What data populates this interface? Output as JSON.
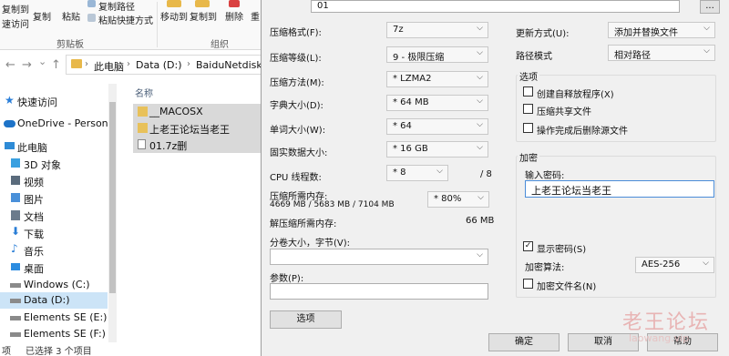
{
  "explorer": {
    "ribbon": {
      "copy_to_label": "复制到",
      "access_label": "速访问",
      "copy_label": "复制",
      "paste_label": "粘贴",
      "copy_path_label": "复制路径",
      "paste_shortcut_label": "粘贴快捷方式",
      "clipboard_group": "剪贴板",
      "move_to_label": "移动到",
      "copy_to2_label": "复制到",
      "delete_label": "删除",
      "rename_label": "重",
      "organize_group": "组织"
    },
    "address": {
      "back": "←",
      "forward": "→",
      "dropdown": "⌄",
      "up": "↑",
      "crumbs": [
        "此电脑",
        "Data (D:)",
        "BaiduNetdiskDown"
      ],
      "separator": "›"
    },
    "nav": [
      {
        "label": "快速访问",
        "icon": "star-icon",
        "color": "#2b7fd9"
      },
      {
        "label": "OneDrive - Personal",
        "icon": "cloud-icon",
        "color": "#1e73c8"
      },
      {
        "label": "此电脑",
        "icon": "computer-icon",
        "color": "#2e8bd6"
      },
      {
        "label": "3D 对象",
        "icon": "cube-icon",
        "color": "#3aa0e0"
      },
      {
        "label": "视频",
        "icon": "video-icon",
        "color": "#5a6b7c"
      },
      {
        "label": "图片",
        "icon": "image-icon",
        "color": "#4a90d9"
      },
      {
        "label": "文档",
        "icon": "document-icon",
        "color": "#6b7b8c"
      },
      {
        "label": "下载",
        "icon": "download-icon",
        "color": "#2a7ed6"
      },
      {
        "label": "音乐",
        "icon": "music-icon",
        "color": "#2a7ed6"
      },
      {
        "label": "桌面",
        "icon": "desktop-icon",
        "color": "#2b8ce0"
      },
      {
        "label": "Windows (C:)",
        "icon": "drive-icon",
        "color": "#888888"
      },
      {
        "label": "Data (D:)",
        "icon": "drive-icon",
        "color": "#888888"
      },
      {
        "label": "Elements SE (E:)",
        "icon": "drive-icon",
        "color": "#888888"
      },
      {
        "label": "Elements SE (F:)",
        "icon": "drive-icon",
        "color": "#888888"
      }
    ],
    "column_header": "名称",
    "files": [
      {
        "name": "__MACOSX",
        "icon": "folder-icon"
      },
      {
        "name": "上老王论坛当老王",
        "icon": "folder-icon"
      },
      {
        "name": "01.7z删",
        "icon": "file-icon"
      }
    ],
    "status": {
      "items": "项",
      "selected": "已选择 3 个项目"
    }
  },
  "dialog": {
    "archive_name": "01",
    "browse_label": "...",
    "format_label": "压缩格式(F):",
    "format_value": "7z",
    "level_label": "压缩等级(L):",
    "level_value": "9 - 极限压缩",
    "method_label": "压缩方法(M):",
    "method_value": "* LZMA2",
    "dict_label": "字典大小(D):",
    "dict_value": "* 64 MB",
    "word_label": "单词大小(W):",
    "word_value": "* 64",
    "solid_label": "固实数据大小:",
    "solid_value": "* 16 GB",
    "threads_label": "CPU 线程数:",
    "threads_value": "* 8",
    "threads_max": "/ 8",
    "mem_comp_label": "压缩所需内存:",
    "mem_comp_value": "4669 MB / 5683 MB / 7104 MB",
    "mem_comp_pct": "* 80%",
    "mem_decomp_label": "解压缩所需内存:",
    "mem_decomp_value": "66 MB",
    "split_label": "分卷大小，字节(V):",
    "split_value": "",
    "params_label": "参数(P):",
    "params_value": "",
    "options_button": "选项",
    "update_label": "更新方式(U):",
    "update_value": "添加并替换文件",
    "path_label": "路径模式",
    "path_value": "相对路径",
    "options_group": "选项",
    "opt_sfx": "创建自释放程序(X)",
    "opt_shared": "压缩共享文件",
    "opt_delete": "操作完成后删除源文件",
    "encrypt_group": "加密",
    "password_label": "输入密码:",
    "password_value": "上老王论坛当老王",
    "show_password": "显示密码(S)",
    "show_password_checked": "✓",
    "enc_method_label": "加密算法:",
    "enc_method_value": "AES-256",
    "encrypt_names": "加密文件名(N)",
    "ok_button": "确定",
    "cancel_button": "取消",
    "help_button": "帮助"
  },
  "watermark": {
    "text": "老王论坛",
    "sub": "laowang.vip"
  }
}
